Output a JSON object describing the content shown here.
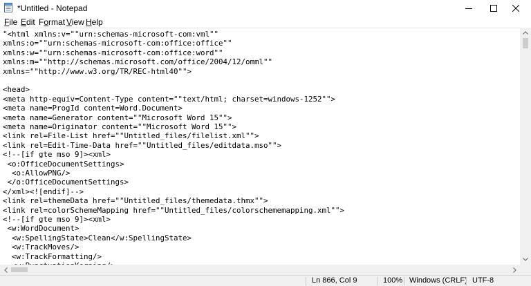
{
  "window": {
    "title": "*Untitled - Notepad",
    "controls": {
      "minimize": "minimize",
      "maximize": "maximize",
      "close": "close"
    }
  },
  "menu": [
    {
      "id": "file",
      "mnemonic": "F",
      "rest": "ile"
    },
    {
      "id": "edit",
      "mnemonic": "E",
      "rest": "dit"
    },
    {
      "id": "format",
      "pre": "F",
      "mnemonic": "o",
      "rest": "rmat"
    },
    {
      "id": "view",
      "mnemonic": "V",
      "rest": "iew"
    },
    {
      "id": "help",
      "mnemonic": "H",
      "rest": "elp"
    }
  ],
  "editor": {
    "lines": [
      "\"<html xmlns:v=\"\"urn:schemas-microsoft-com:vml\"\"",
      "xmlns:o=\"\"urn:schemas-microsoft-com:office:office\"\"",
      "xmlns:w=\"\"urn:schemas-microsoft-com:office:word\"\"",
      "xmlns:m=\"\"http://schemas.microsoft.com/office/2004/12/omml\"\"",
      "xmlns=\"\"http://www.w3.org/TR/REC-html40\"\">",
      "",
      "<head>",
      "<meta http-equiv=Content-Type content=\"\"text/html; charset=windows-1252\"\">",
      "<meta name=ProgId content=Word.Document>",
      "<meta name=Generator content=\"\"Microsoft Word 15\"\">",
      "<meta name=Originator content=\"\"Microsoft Word 15\"\">",
      "<link rel=File-List href=\"\"Untitled_files/filelist.xml\"\">",
      "<link rel=Edit-Time-Data href=\"\"Untitled_files/editdata.mso\"\">",
      "<!--[if gte mso 9]><xml>",
      " <o:OfficeDocumentSettings>",
      "  <o:AllowPNG/>",
      " </o:OfficeDocumentSettings>",
      "</xml><![endif]-->",
      "<link rel=themeData href=\"\"Untitled_files/themedata.thmx\"\">",
      "<link rel=colorSchemeMapping href=\"\"Untitled_files/colorschememapping.xml\"\">",
      "<!--[if gte mso 9]><xml>",
      " <w:WordDocument>",
      "  <w:SpellingState>Clean</w:SpellingState>",
      "  <w:TrackMoves/>",
      "  <w:TrackFormatting/>",
      "  <w:PunctuationKerning/>"
    ]
  },
  "status": {
    "position": "Ln 866, Col 9",
    "zoom": "100%",
    "line_ending": "Windows (CRLF)",
    "encoding": "UTF-8"
  },
  "colors": {
    "chrome": "#f0f0f0",
    "scroll_thumb": "#cdcdcd",
    "text": "#000000"
  }
}
